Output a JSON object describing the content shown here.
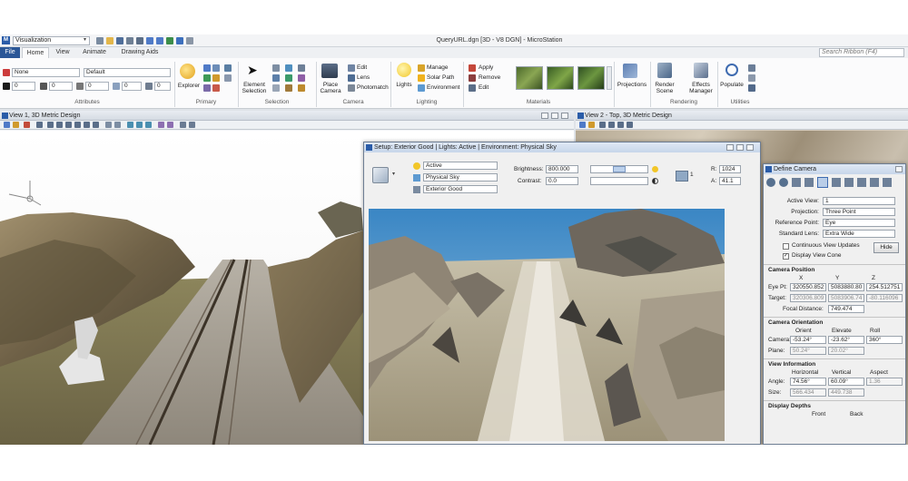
{
  "titlebar": {
    "workflow": "Visualization",
    "title": "QueryURL.dgn [3D - V8 DGN] - MicroStation"
  },
  "tabs": [
    "File",
    "Home",
    "View",
    "Animate",
    "Drawing Aids"
  ],
  "search_placeholder": "Search Ribbon (F4)",
  "attributes": {
    "level": "None",
    "style": "Default",
    "color_value": "0",
    "weight_value": "0",
    "line_style_value": "0",
    "transparency_value": "0",
    "priority_value": "0",
    "label": "Attributes"
  },
  "groups": {
    "primary": "Primary",
    "selection": "Selection",
    "camera": "Camera",
    "lighting": "Lighting",
    "materials": "Materials",
    "rendering": "Rendering",
    "utilities": "Utilities"
  },
  "buttons": {
    "explorer": "Explorer",
    "element_selection_1": "Element",
    "element_selection_2": "Selection",
    "place_camera_1": "Place",
    "place_camera_2": "Camera",
    "edit": "Edit",
    "lens": "Lens",
    "photomatch": "Photomatch",
    "lights": "Lights",
    "manage": "Manage",
    "solar_path": "Solar Path",
    "environment": "Environment",
    "apply": "Apply",
    "remove": "Remove",
    "materials_edit": "Edit",
    "projections": "Projections",
    "render_scene_1": "Render",
    "render_scene_2": "Scene",
    "effects_manager_1": "Effects",
    "effects_manager_2": "Manager",
    "populate": "Populate"
  },
  "view1": {
    "title": "View 1, 3D Metric Design"
  },
  "view2": {
    "title": "View 2 - Top, 3D Metric Design"
  },
  "setup_dialog": {
    "title": "Setup: Exterior Good | Lights: Active | Environment: Physical Sky",
    "light_setup": "Active",
    "environment": "Physical Sky",
    "setup": "Exterior Good",
    "brightness_label": "Brightness:",
    "brightness_value": "800.000",
    "contrast_label": "Contrast:",
    "contrast_value": "0.0",
    "resolution_r": "R:",
    "resolution_value": "1024",
    "resolution_a": "A:",
    "aspect_value": "41.1",
    "page_value": "1"
  },
  "camera_dialog": {
    "title": "Define Camera",
    "active_view_label": "Active View:",
    "active_view": "1",
    "projection_label": "Projection:",
    "projection": "Three Point",
    "reference_point_label": "Reference Point:",
    "reference_point": "Eye",
    "standard_lens_label": "Standard Lens:",
    "standard_lens": "Extra Wide",
    "continuous_update": "Continuous View Updates",
    "display_view_cone": "Display View Cone",
    "hide_button": "Hide",
    "camera_position": "Camera Position",
    "col_x": "X",
    "col_y": "Y",
    "col_z": "Z",
    "eye_label": "Eye Pt:",
    "eye_x": "320550.852",
    "eye_y": "5083880.80",
    "eye_z": "254.512751",
    "target_label": "Target:",
    "target_x": "320306.809",
    "target_y": "5083906.74",
    "target_z": "-80.116096",
    "focal_label": "Focal Distance:",
    "focal_value": "749.474",
    "camera_orientation": "Camera Orientation",
    "col_orient": "Orient",
    "col_elevate": "Elevate",
    "col_roll": "Roll",
    "camera_label": "Camera:",
    "cam_orient": "-53.24°",
    "cam_elevate": "-23.62°",
    "cam_roll": "360°",
    "plane_label": "Plane:",
    "plane_orient": "50.24°",
    "plane_elevate": "20.02°",
    "view_information": "View Information",
    "col_horizontal": "Horizontal",
    "col_vertical": "Vertical",
    "col_aspect": "Aspect",
    "angle_label": "Angle:",
    "angle_h": "74.56°",
    "angle_v": "60.09°",
    "angle_aspect": "1.36",
    "size_label": "Size:",
    "size_h": "566.434",
    "size_v": "449.738",
    "display_depths": "Display Depths",
    "col_front": "Front",
    "col_back": "Back"
  },
  "colors": {
    "file_tab": "#2b5797",
    "ribbon_bg": "#fbfbfc",
    "dialog_title": "#c7d6ea"
  }
}
